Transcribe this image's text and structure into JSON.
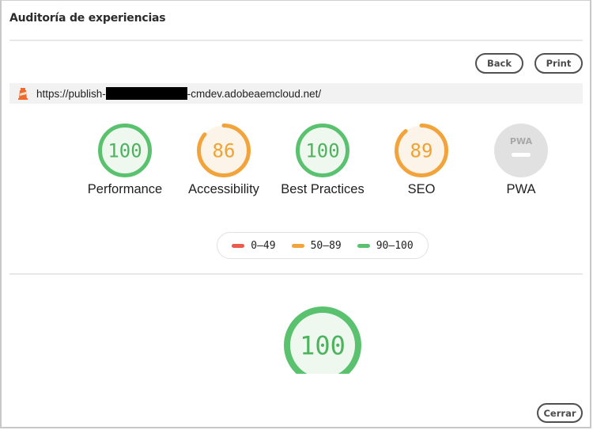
{
  "dialog": {
    "title": "Auditoría de experiencias",
    "close_label": "Cerrar"
  },
  "toolbar": {
    "back_label": "Back",
    "print_label": "Print"
  },
  "url_bar": {
    "icon": "lighthouse-icon",
    "prefix": "https://publish-",
    "suffix": "-cmdev.adobeaemcloud.net/",
    "redacted": true
  },
  "colors": {
    "pass": "#0cce6b",
    "pass_stroke": "#5ac26e",
    "pass_fill": "#eef8ef",
    "pass_text": "#4db35e",
    "average": "#f2a33a",
    "average_fill": "#fdf4e9",
    "average_text": "#f0a232",
    "fail": "#eb5a4b",
    "na_fill": "#e1e1e1",
    "na_text": "#a8a8a8"
  },
  "gauges": [
    {
      "label": "Performance",
      "score": "100",
      "value": 100,
      "rating": "pass"
    },
    {
      "label": "Accessibility",
      "score": "86",
      "value": 86,
      "rating": "average"
    },
    {
      "label": "Best Practices",
      "score": "100",
      "value": 100,
      "rating": "pass"
    },
    {
      "label": "SEO",
      "score": "89",
      "value": 89,
      "rating": "average"
    },
    {
      "label": "PWA",
      "score": "PWA",
      "value": null,
      "rating": "na",
      "icon": "pwa-icon"
    }
  ],
  "legend": [
    {
      "range": "0–49",
      "rating": "fail"
    },
    {
      "range": "50–89",
      "rating": "average"
    },
    {
      "range": "90–100",
      "rating": "pass"
    }
  ],
  "detail_gauge": {
    "score": "100",
    "value": 100,
    "rating": "pass"
  }
}
